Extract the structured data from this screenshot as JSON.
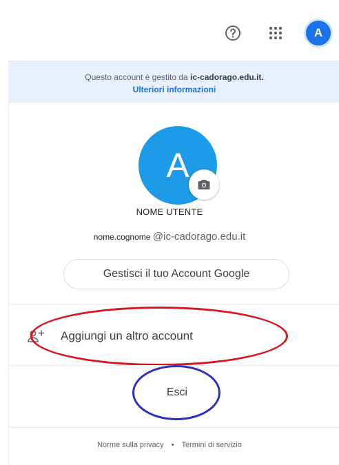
{
  "topbar": {
    "avatar_initial": "A"
  },
  "managed_notice": {
    "text": "Questo account è gestito da",
    "domain": "ic-cadorago.edu.it.",
    "link": "Ulteriori informazioni"
  },
  "profile": {
    "avatar_initial": "A",
    "name": "NOME UTENTE",
    "email_local": "nome.cognome",
    "email_domain": "@ic-cadorago.edu.it"
  },
  "actions": {
    "manage_account": "Gestisci il tuo Account Google",
    "add_account": "Aggiungi un altro account",
    "sign_out": "Esci"
  },
  "footer": {
    "privacy": "Norme sulla privacy",
    "separator": "•",
    "terms": "Termini di servizio"
  },
  "colors": {
    "accent": "#1a73e8",
    "avatar": "#1e9be6",
    "highlight_red": "#d9131f",
    "highlight_blue": "#2d2fbd",
    "notice_bg": "#e8f0fe"
  },
  "icons": {
    "help": "help-circle-icon",
    "apps": "apps-grid-icon",
    "camera": "camera-icon",
    "add_person": "person-add-icon"
  }
}
